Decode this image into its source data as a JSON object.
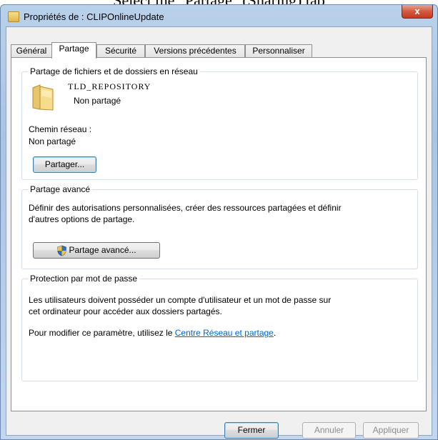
{
  "caption": "Select the \"Partage\" (Sharing) tab",
  "window": {
    "title": "Propriétés de : CLIPOnlineUpdate",
    "close_label": "x"
  },
  "tabs": [
    "Général",
    "Partage",
    "Sécurité",
    "Versions précédentes",
    "Personnaliser"
  ],
  "active_tab": "Partage",
  "sharing": {
    "group_title": "Partage de fichiers et de dossiers en réseau",
    "folder_name": "TLD_REPOSITORY",
    "share_status": "Non partagé",
    "network_path_label": "Chemin réseau :",
    "network_path_value": "Non partagé",
    "share_button": "Partager..."
  },
  "advanced": {
    "group_title": "Partage avancé",
    "description_line1": "Définir des autorisations personnalisées, créer des ressources partagées et définir",
    "description_line2": "d'autres options de partage.",
    "button": "Partage avancé..."
  },
  "password": {
    "group_title": "Protection par mot de passe",
    "description_line1": "Les utilisateurs doivent posséder un compte d'utilisateur et un mot de passe sur",
    "description_line2": "cet ordinateur pour accéder aux dossiers partagés.",
    "modify_prefix": "Pour modifier ce paramètre, utilisez le ",
    "link_text": "Centre Réseau et partage",
    "modify_suffix": "."
  },
  "footer": {
    "close": "Fermer",
    "cancel": "Annuler",
    "apply": "Appliquer"
  }
}
